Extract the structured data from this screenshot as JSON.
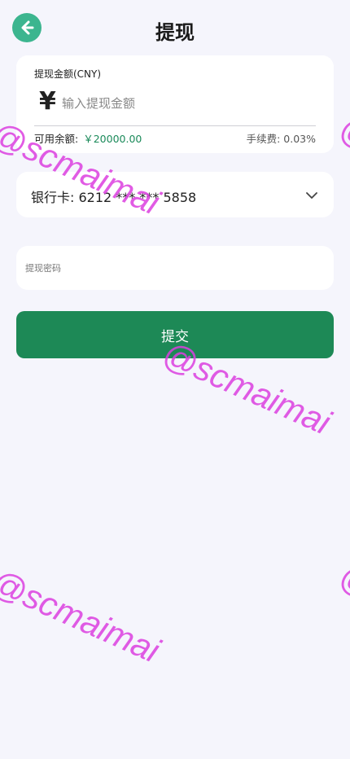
{
  "header": {
    "title": "提现",
    "back_icon": "arrow-left-icon"
  },
  "amount": {
    "label": "提现金额(CNY)",
    "currency_symbol": "¥",
    "placeholder": "输入提现金额",
    "balance_label": "可用余额:",
    "balance_value": "￥20000.00",
    "fee_text": "手续费: 0.03%"
  },
  "bank": {
    "text": "银行卡: 6212 *** *** 5858",
    "chevron_icon": "chevron-down-icon"
  },
  "password": {
    "placeholder": "提现密码"
  },
  "submit": {
    "label": "提交"
  },
  "watermark": {
    "text": "@scmaimai",
    "edge_text": "@"
  },
  "colors": {
    "accent": "#1d8956",
    "back_button": "#3cb58f",
    "balance": "#1b8a5a",
    "watermark": "#dc3fe0",
    "background": "#f5f5fc"
  }
}
